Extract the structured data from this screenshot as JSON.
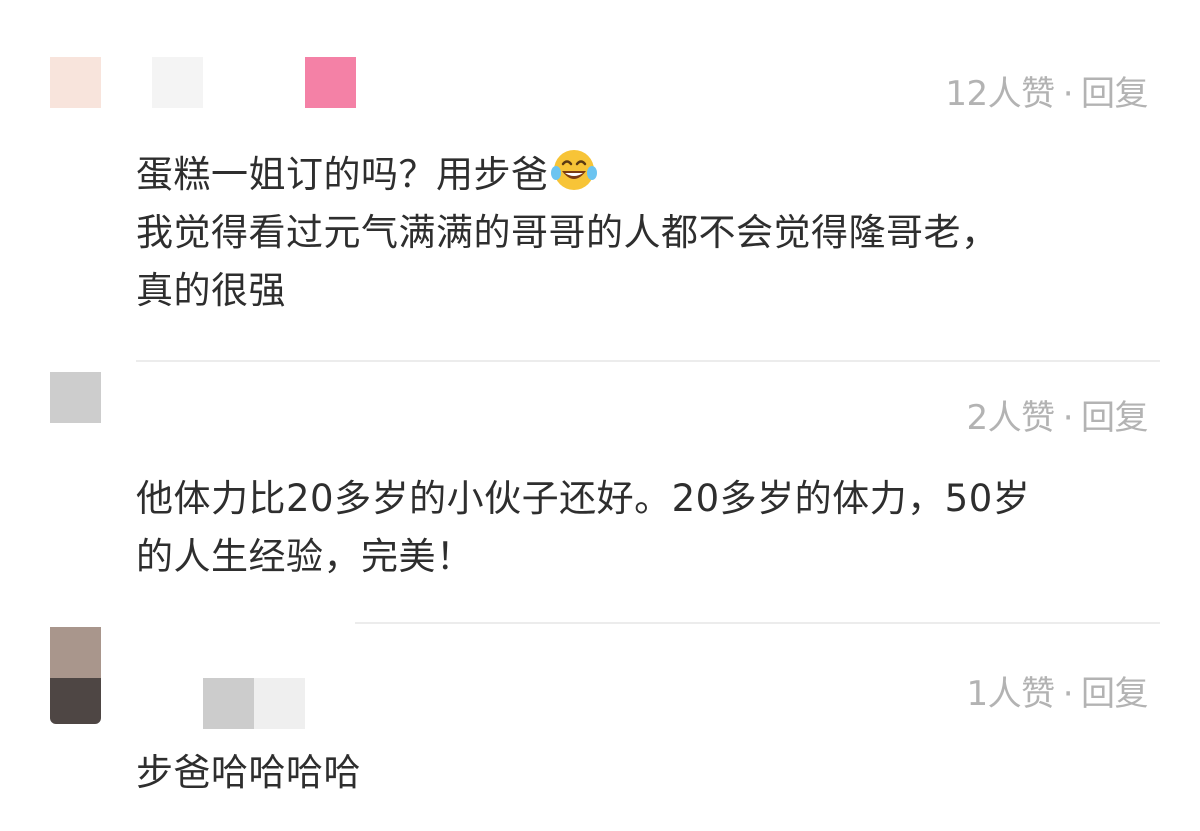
{
  "comments": [
    {
      "likes": "12人赞",
      "separator": "·",
      "reply": "回复",
      "lines": [
        "蛋糕一姐订的吗？用步爸",
        "我觉得看过元气满满的哥哥的人都不会觉得隆哥老，",
        "真的很强"
      ],
      "emoji": "laughing-tears-icon",
      "avatar_colors": [
        "#f8e4dc",
        "#f4f4f4",
        "#f481a6"
      ]
    },
    {
      "likes": "2人赞",
      "separator": "·",
      "reply": "回复",
      "lines": [
        "他体力比20多岁的小伙子还好。20多岁的体力，50岁",
        "的人生经验，完美！"
      ],
      "avatar_colors": [
        "#cdcdcd"
      ]
    },
    {
      "likes": "1人赞",
      "separator": "·",
      "reply": "回复",
      "lines": [
        "步爸哈哈哈哈"
      ],
      "avatar_colors": [
        "#a9968c",
        "#4e4644",
        "#cccccc",
        "#efefef"
      ]
    }
  ],
  "colors": {
    "meta_text": "#b3b3b3",
    "body_text": "#2e2e2e",
    "divider": "#ececec"
  }
}
